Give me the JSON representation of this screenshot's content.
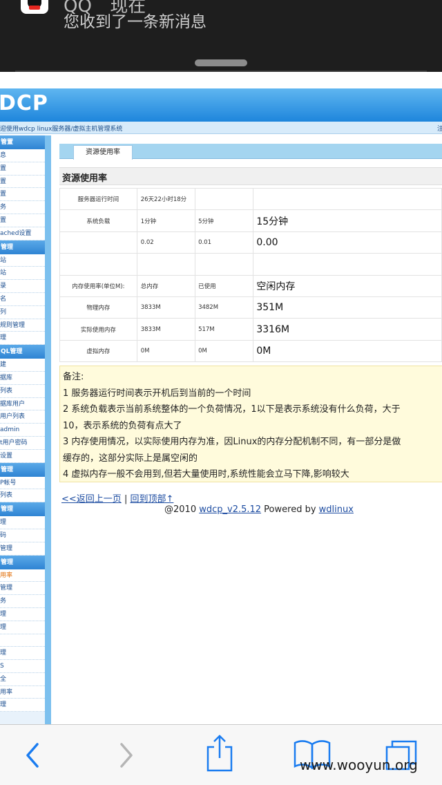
{
  "notification": {
    "app": "QQ",
    "time": "现在",
    "message": "您收到了一条新消息",
    "icon": "qq-penguin-icon"
  },
  "site": {
    "logo": "DCP",
    "welcome": "迎使用wdcp linux服务器/虚拟主机管理系统",
    "welcome_right": "注"
  },
  "sidebar": {
    "groups": [
      {
        "title": "管置",
        "items": [
          "息",
          "置",
          "置",
          "置",
          "务",
          "置",
          "ached设置"
        ]
      },
      {
        "title": "管理",
        "items": [
          "站",
          "站",
          "录",
          "名",
          "列",
          "规则管理",
          "理"
        ]
      },
      {
        "title": "QL管理",
        "items": [
          "建",
          "据库",
          "列表",
          "据库用户",
          "用户列表",
          "admin",
          "t用户密码",
          "设置"
        ]
      },
      {
        "title": "管理",
        "items": [
          "P帐号",
          "列表"
        ]
      },
      {
        "title": "管理",
        "items": [
          "理",
          "码",
          "管理"
        ]
      },
      {
        "title": "管理",
        "items": [
          "用率",
          "管理",
          "务",
          "理",
          "理",
          "",
          "理",
          "S",
          "全",
          "用率",
          "理"
        ]
      }
    ],
    "active_item": "用率"
  },
  "tab": "资源使用率",
  "panel_title": "资源使用率",
  "table": [
    [
      "服务器运行时间",
      "26天22小时18分",
      "",
      ""
    ],
    [
      "系统负载",
      "1分钟",
      "5分钟",
      "15分钟"
    ],
    [
      "",
      "0.02",
      "0.01",
      "0.00"
    ],
    [
      "",
      "",
      "",
      ""
    ],
    [
      "内存使用率(单位M):",
      "总内存",
      "已使用",
      "空闲内存"
    ],
    [
      "物理内存",
      "3833M",
      "3482M",
      "351M"
    ],
    [
      "实际使用内存",
      "3833M",
      "517M",
      "3316M"
    ],
    [
      "虚拟内存",
      "0M",
      "0M",
      "0M"
    ]
  ],
  "notes": [
    "备注:",
    "1 服务器运行时间表示开机后到当前的一个时间",
    "2 系统负载表示当前系统整体的一个负荷情况，1以下是表示系统没有什么负荷，大于",
    "10，表示系统的负荷有点大了",
    "3 内存使用情况，以实际使用内存为准，因Linux的内存分配机制不同，有一部分是做",
    "缓存的，这部分实际上是属空闲的",
    "4 虚拟内存一般不会用到,但若大量使用时,系统性能会立马下降,影响较大"
  ],
  "links": {
    "back": "<<返回上一页",
    "separator": "|",
    "top": "回到顶部↑"
  },
  "footer": {
    "prefix": "@2010 ",
    "version": "wdcp_v2.5.12",
    "middle": " Powered by ",
    "brand": "wdlinux"
  },
  "toolbar": {
    "back": "back-icon",
    "forward": "forward-icon",
    "share": "share-icon",
    "bookmarks": "bookmarks-icon",
    "tabs": "tabs-icon"
  },
  "watermark": "www.wooyun.org"
}
